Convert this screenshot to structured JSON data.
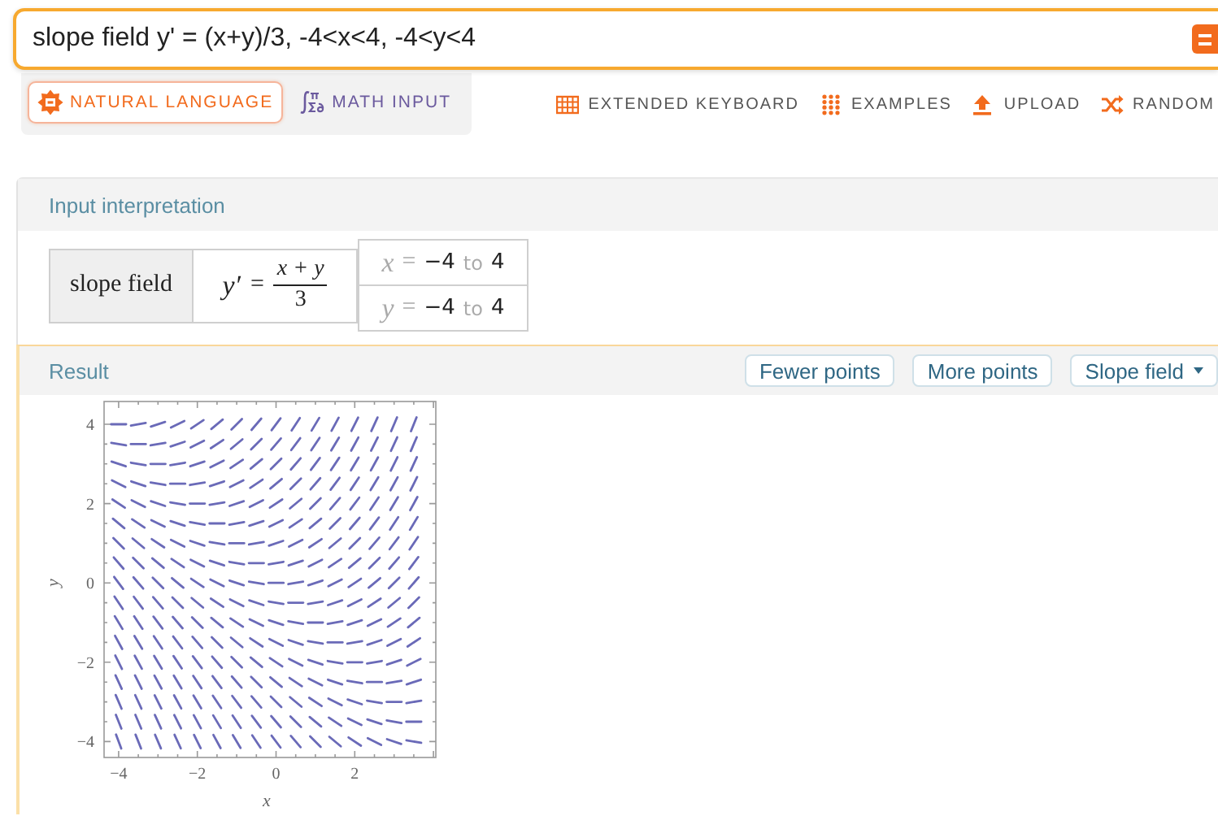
{
  "search": {
    "value": "slope field y' = (x+y)/3, -4<x<4, -4<y<4"
  },
  "input_modes": [
    {
      "label": "NATURAL LANGUAGE",
      "kind": "natural",
      "selected": true
    },
    {
      "label": "MATH INPUT",
      "kind": "math",
      "selected": false
    }
  ],
  "tools": [
    {
      "label": "EXTENDED KEYBOARD",
      "kind": "keyboard"
    },
    {
      "label": "EXAMPLES",
      "kind": "examples"
    },
    {
      "label": "UPLOAD",
      "kind": "upload"
    },
    {
      "label": "RANDOM",
      "kind": "random"
    }
  ],
  "input_interpretation": {
    "title": "Input interpretation",
    "label": "slope field",
    "formula": {
      "lhs": "y′",
      "relation": "=",
      "numerator": "x + y",
      "denominator": "3"
    },
    "ranges": [
      {
        "variable": "x",
        "relation": "=",
        "from": "−4",
        "word": "to",
        "to": "4"
      },
      {
        "variable": "y",
        "relation": "=",
        "from": "−4",
        "word": "to",
        "to": "4"
      }
    ]
  },
  "result": {
    "title": "Result",
    "buttons": [
      {
        "label": "Fewer points",
        "kind": "button"
      },
      {
        "label": "More points",
        "kind": "button"
      },
      {
        "label": "Slope field",
        "kind": "dropdown"
      }
    ],
    "plot": {
      "xlabel": "x",
      "ylabel": "y",
      "xticks": [
        "−4",
        "−2",
        "0",
        "2"
      ],
      "yticks": [
        "4",
        "2",
        "0",
        "−2",
        "−4"
      ]
    }
  }
}
